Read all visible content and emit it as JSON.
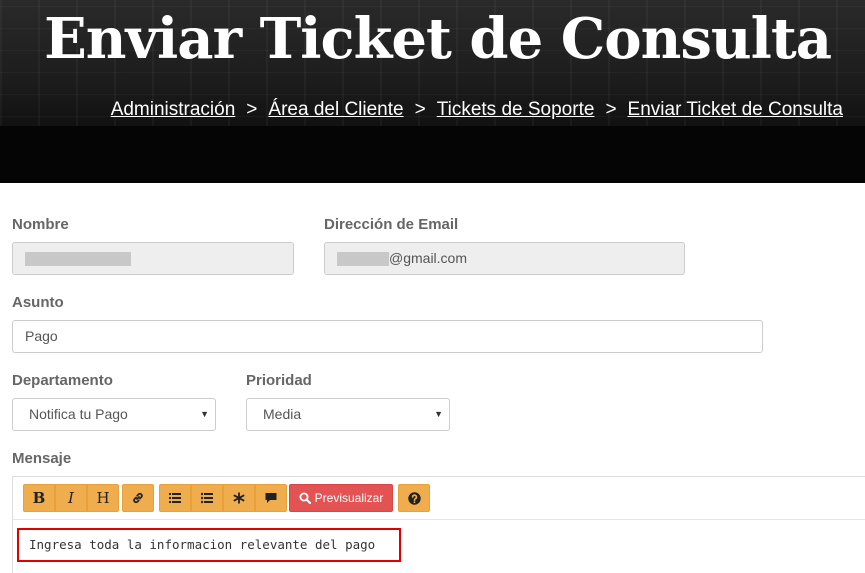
{
  "header": {
    "title": "Enviar Ticket de Consulta",
    "breadcrumb": [
      {
        "label": "Administración"
      },
      {
        "label": "Área del Cliente"
      },
      {
        "label": "Tickets de Soporte"
      },
      {
        "label": "Enviar Ticket de Consulta"
      }
    ],
    "separator": ">"
  },
  "form": {
    "name_label": "Nombre",
    "email_label": "Dirección de Email",
    "email_value_suffix": "@gmail.com",
    "subject_label": "Asunto",
    "subject_value": "Pago",
    "department_label": "Departamento",
    "department_value": "Notifica tu Pago",
    "priority_label": "Prioridad",
    "priority_value": "Media",
    "message_label": "Mensaje",
    "message_value": "Ingresa toda la informacion relevante del pago"
  },
  "toolbar": {
    "bold": "B",
    "italic": "I",
    "heading": "H",
    "preview_label": "Previsualizar",
    "icons": [
      "bold-icon",
      "italic-icon",
      "heading-icon",
      "link-icon",
      "ordered-list-icon",
      "unordered-list-icon",
      "code-icon",
      "quote-icon",
      "search-icon",
      "help-icon"
    ]
  },
  "colors": {
    "toolbar_button": "#f0ad4e",
    "preview_button": "#e35353",
    "highlight_border": "#e00000"
  }
}
